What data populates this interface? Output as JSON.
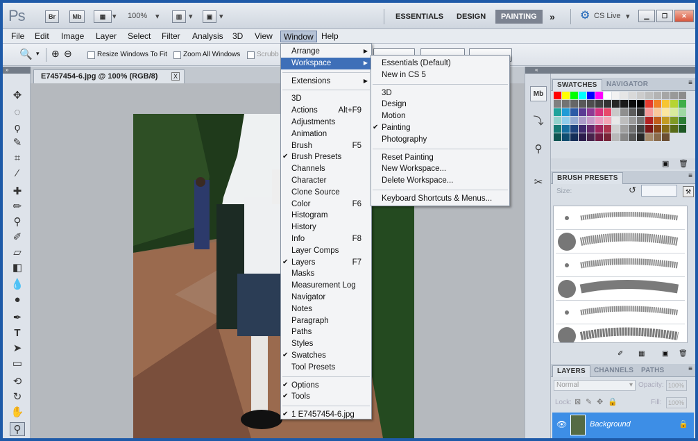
{
  "app": {
    "logo": "Ps",
    "bridge": "Br",
    "minibridge": "Mb",
    "zoom": "100%",
    "workspaces": [
      "ESSENTIALS",
      "DESIGN",
      "PAINTING"
    ],
    "overflow": "»",
    "cslive": "CS Live",
    "window_controls": [
      "minimize-icon",
      "restore-icon",
      "close-icon"
    ]
  },
  "menubar": [
    "File",
    "Edit",
    "Image",
    "Layer",
    "Select",
    "Filter",
    "Analysis",
    "3D",
    "View",
    "Window",
    "Help"
  ],
  "options": {
    "resize_windows": "Resize Windows To Fit",
    "zoom_all": "Zoom All Windows",
    "scrubby": "Scrubb"
  },
  "document": {
    "tab_title": "E7457454-6.jpg @ 100% (RGB/8)",
    "close": "X"
  },
  "window_menu": {
    "items": [
      {
        "label": "Arrange",
        "arrow": "▶"
      },
      {
        "label": "Workspace",
        "arrow": "▶",
        "highlight": true
      },
      {
        "divider": true
      },
      {
        "label": "Extensions",
        "arrow": "▶"
      },
      {
        "divider": true
      },
      {
        "label": "3D"
      },
      {
        "label": "Actions",
        "shortcut": "Alt+F9"
      },
      {
        "label": "Adjustments"
      },
      {
        "label": "Animation"
      },
      {
        "label": "Brush",
        "shortcut": "F5"
      },
      {
        "label": "Brush Presets",
        "checked": true
      },
      {
        "label": "Channels"
      },
      {
        "label": "Character"
      },
      {
        "label": "Clone Source"
      },
      {
        "label": "Color",
        "shortcut": "F6"
      },
      {
        "label": "Histogram"
      },
      {
        "label": "History"
      },
      {
        "label": "Info",
        "shortcut": "F8"
      },
      {
        "label": "Layer Comps"
      },
      {
        "label": "Layers",
        "shortcut": "F7",
        "checked": true
      },
      {
        "label": "Masks"
      },
      {
        "label": "Measurement Log"
      },
      {
        "label": "Navigator"
      },
      {
        "label": "Notes"
      },
      {
        "label": "Paragraph"
      },
      {
        "label": "Paths"
      },
      {
        "label": "Styles"
      },
      {
        "label": "Swatches",
        "checked": true
      },
      {
        "label": "Tool Presets"
      },
      {
        "divider": true
      },
      {
        "label": "Options",
        "checked": true
      },
      {
        "label": "Tools",
        "checked": true
      },
      {
        "divider": true
      },
      {
        "label": "1 E7457454-6.jpg",
        "checked": true
      }
    ]
  },
  "workspace_menu": {
    "items": [
      {
        "label": "Essentials (Default)"
      },
      {
        "label": "New in CS 5"
      },
      {
        "divider": true
      },
      {
        "label": "3D"
      },
      {
        "label": "Design"
      },
      {
        "label": "Motion"
      },
      {
        "label": "Painting",
        "checked": true
      },
      {
        "label": "Photography"
      },
      {
        "divider": true
      },
      {
        "label": "Reset Painting"
      },
      {
        "label": "New Workspace..."
      },
      {
        "label": "Delete Workspace..."
      },
      {
        "divider": true
      },
      {
        "label": "Keyboard Shortcuts & Menus..."
      }
    ]
  },
  "panels": {
    "swatches_tabs": [
      "SWATCHES",
      "NAVIGATOR"
    ],
    "brush_tab": "BRUSH PRESETS",
    "size_label": "Size:",
    "layers_tabs": [
      "LAYERS",
      "CHANNELS",
      "PATHS"
    ],
    "blend_mode": "Normal",
    "opacity_label": "Opacity:",
    "opacity_value": "100%",
    "lock_label": "Lock:",
    "fill_label": "Fill:",
    "fill_value": "100%",
    "layer_name": "Background"
  },
  "swatch_colors": [
    "#ff0000",
    "#ffff00",
    "#00ff00",
    "#00ffff",
    "#0000ff",
    "#ff00ff",
    "#ffffff",
    "#f2f2f2",
    "#e6e6e6",
    "#d9d9d9",
    "#cccccc",
    "#bfbfbf",
    "#b3b3b3",
    "#a6a6a6",
    "#999999",
    "#8c8c8c",
    "#808080",
    "#737373",
    "#666666",
    "#595959",
    "#4d4d4d",
    "#404040",
    "#333333",
    "#262626",
    "#1a1a1a",
    "#0d0d0d",
    "#000000",
    "#e63b2e",
    "#f07e26",
    "#f7c531",
    "#b6d433",
    "#3fae49",
    "#1fa39b",
    "#1f9bd6",
    "#2c5aa6",
    "#5a3a93",
    "#8e3a93",
    "#d6337e",
    "#e8496a",
    "#c9c9c9",
    "#8f8f8f",
    "#5c5c5c",
    "#303030",
    "#f59a9a",
    "#f9c89b",
    "#fbe6a0",
    "#d8eb9d",
    "#9fd8a3",
    "#92d2cd",
    "#8fcdeb",
    "#95abd3",
    "#ac9bc9",
    "#c79ac9",
    "#eb99bf",
    "#f4a4b5",
    "#e8e8e8",
    "#bdbdbd",
    "#9a9a9a",
    "#767676",
    "#b22222",
    "#c25f1b",
    "#c29b22",
    "#7f9a23",
    "#2b7e34",
    "#167a74",
    "#176fa0",
    "#1f437e",
    "#3f2a6d",
    "#66296b",
    "#9f255d",
    "#ad344e",
    "#d0d0d0",
    "#a0a0a0",
    "#707070",
    "#404040",
    "#7b1717",
    "#874214",
    "#876c17",
    "#586b18",
    "#1d5824",
    "#0f5551",
    "#104e70",
    "#152e58",
    "#2c1d4c",
    "#47234b",
    "#6f1a41",
    "#792437",
    "#b8b8b8",
    "#888888",
    "#585858",
    "#282828",
    "#a68b6c",
    "#8a6b4c",
    "#6b4e32"
  ]
}
